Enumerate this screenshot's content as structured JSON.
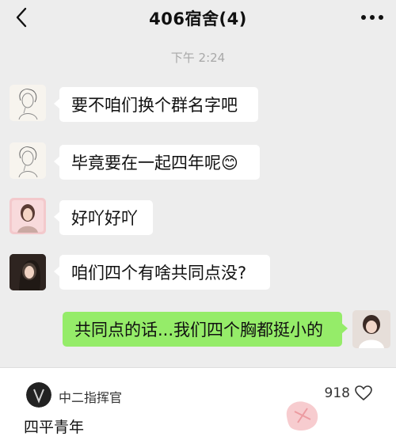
{
  "header": {
    "title": "406宿舍(4)",
    "back_icon": "chevron-left-icon",
    "more_icon": "ellipsis-icon"
  },
  "timestamp": "下午 2:24",
  "messages": [
    {
      "side": "in",
      "avatar": "sketch-portrait-avatar",
      "text": "要不咱们换个群名字吧"
    },
    {
      "side": "in",
      "avatar": "sketch-portrait-avatar",
      "text": "毕竟要在一起四年呢😊"
    },
    {
      "side": "in",
      "avatar": "pink-portrait-avatar",
      "text": "好吖好吖"
    },
    {
      "side": "in",
      "avatar": "dark-hair-portrait-avatar",
      "text": "咱们四个有啥共同点没?"
    },
    {
      "side": "out",
      "avatar": "self-portrait-avatar",
      "text": "共同点的话...我们四个胸都挺小的"
    }
  ],
  "comment": {
    "username": "中二指挥官",
    "likes": "918",
    "like_icon": "heart-outline-icon",
    "text": "四平青年"
  },
  "colors": {
    "background": "#ededed",
    "incoming_bubble": "#ffffff",
    "outgoing_bubble": "#95ec69"
  }
}
